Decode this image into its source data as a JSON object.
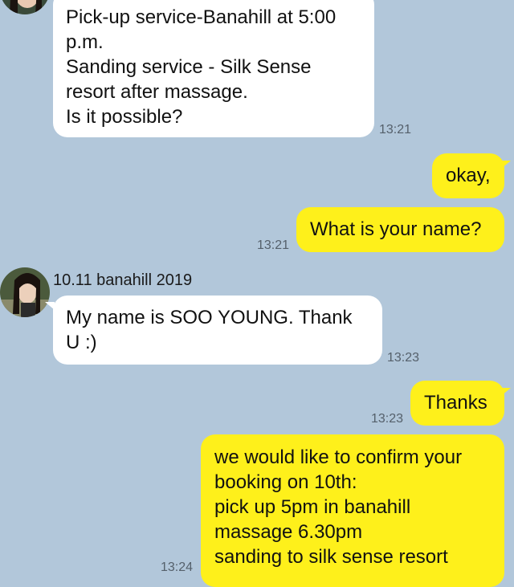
{
  "messages": {
    "m1": {
      "lines": [
        "Pick-up service-Banahill at 5:00",
        "p.m.",
        "Sanding service - Silk Sense",
        "resort after massage.",
        "Is it possible?"
      ],
      "time": "13:21"
    },
    "m2": {
      "text": "okay,"
    },
    "m3": {
      "text": "What is your name?",
      "time": "13:21"
    },
    "m4": {
      "sender": "10.11 banahill 2019",
      "lines": [
        "My name is SOO YOUNG. Thank",
        "U :)"
      ],
      "time": "13:23"
    },
    "m5": {
      "text": "Thanks",
      "time": "13:23"
    },
    "m6": {
      "lines": [
        "we would like to confirm your",
        "booking on 10th:",
        "pick up 5pm in banahill",
        "massage 6.30pm",
        "sanding to silk sense resort"
      ],
      "time": "13:24"
    }
  },
  "colors": {
    "background": "#b2c7da",
    "incoming_bubble": "#ffffff",
    "outgoing_bubble": "#fef01b"
  }
}
